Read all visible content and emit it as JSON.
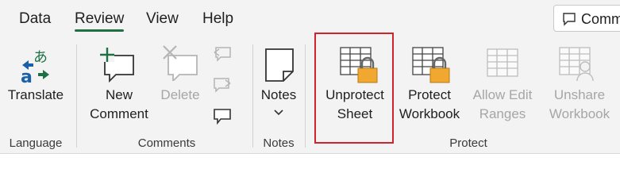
{
  "tabs": [
    {
      "label": "Data"
    },
    {
      "label": "Review"
    },
    {
      "label": "View"
    },
    {
      "label": "Help"
    }
  ],
  "comments_button": {
    "label": "Comm"
  },
  "buttons": {
    "translate": "Translate",
    "new_comment_1": "New",
    "new_comment_2": "Comment",
    "delete": "Delete",
    "notes": "Notes",
    "unprotect_1": "Unprotect",
    "unprotect_2": "Sheet",
    "protect_wb_1": "Protect",
    "protect_wb_2": "Workbook",
    "allow_edit_1": "Allow Edit",
    "allow_edit_2": "Ranges",
    "unshare_1": "Unshare",
    "unshare_2": "Workbook"
  },
  "groups": {
    "language": "Language",
    "comments": "Comments",
    "notes": "Notes",
    "protect": "Protect"
  },
  "colors": {
    "accent": "#1f7145",
    "highlight": "#d0242c",
    "lock": "#f0a830"
  }
}
